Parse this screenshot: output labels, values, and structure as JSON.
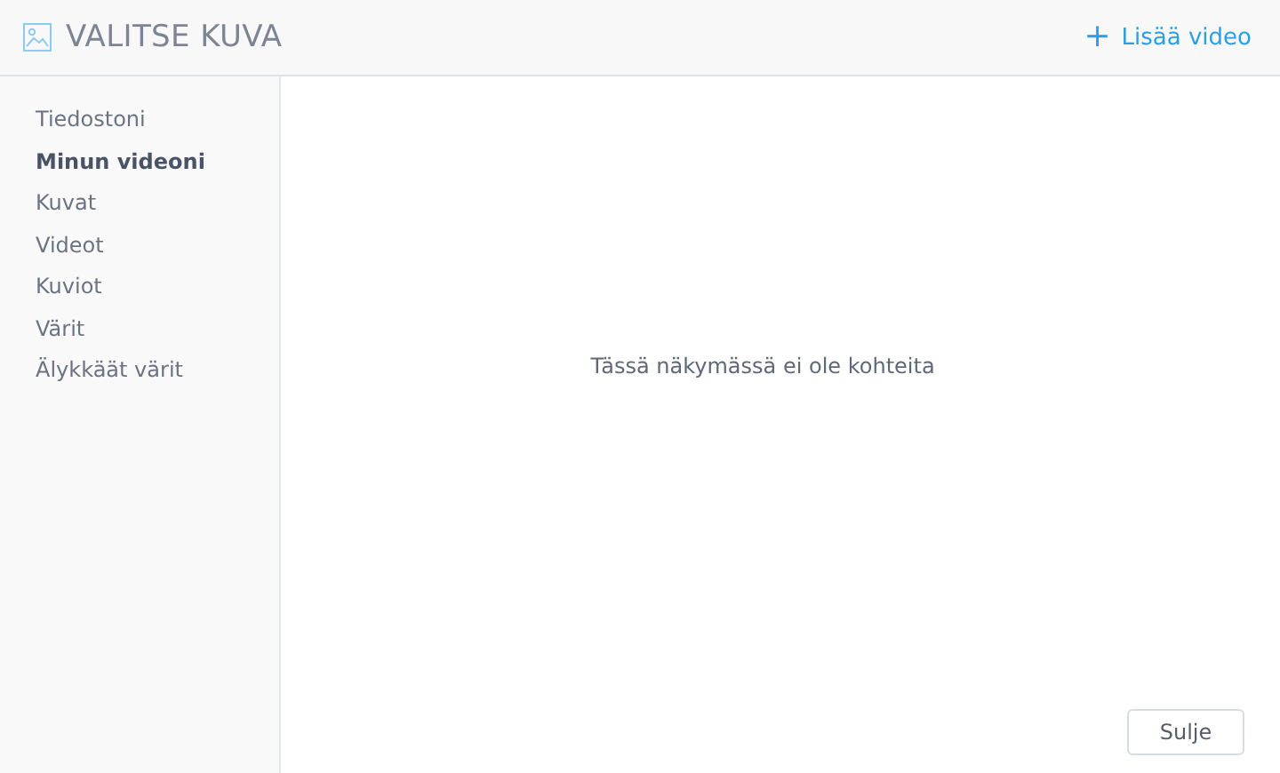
{
  "header": {
    "title": "VALITSE KUVA",
    "add_button": {
      "icon": "+",
      "label": "Lisää video"
    }
  },
  "sidebar": {
    "items": [
      {
        "label": "Tiedostoni",
        "selected": false
      },
      {
        "label": "Minun videoni",
        "selected": true
      },
      {
        "label": "Kuvat",
        "selected": false
      },
      {
        "label": "Videot",
        "selected": false
      },
      {
        "label": "Kuviot",
        "selected": false
      },
      {
        "label": "Värit",
        "selected": false
      },
      {
        "label": "Älykkäät värit",
        "selected": false
      }
    ]
  },
  "content": {
    "empty_message": "Tässä näkymässä ei ole kohteita"
  },
  "buttons": {
    "close": "Sulje"
  }
}
